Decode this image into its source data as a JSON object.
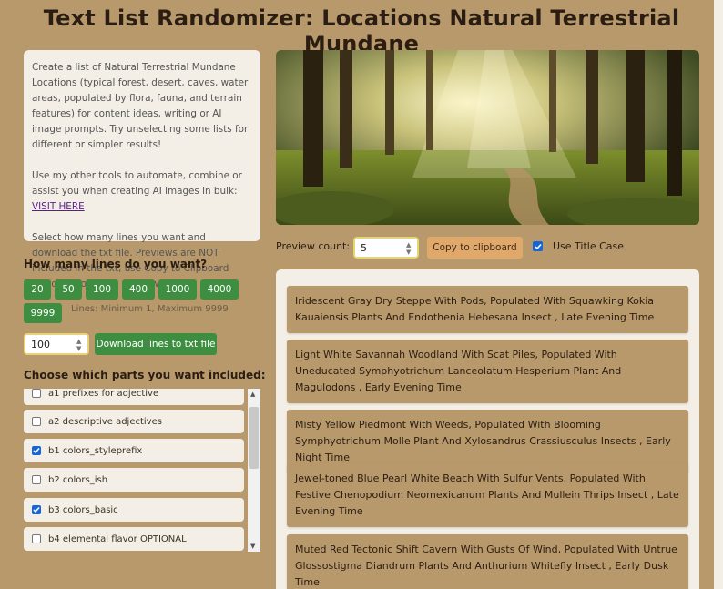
{
  "page_title": "Text List Randomizer: Locations Natural Terrestrial Mundane",
  "description": {
    "p1": "Create a list of Natural Terrestrial Mundane Locations (typical forest, desert, caves, water areas, populated by flora, fauna, and terrain features) for content ideas, writing or AI image prompts. Try unselecting some lists for different or simpler results!",
    "p2_text": "Use my other tools to automate, combine or assist you when creating AI images in bulk: ",
    "p2_link": "VISIT HERE",
    "p3": "Select how many lines you want and download the txt file. Previews are NOT included in the txt, use Copy to Clipboard button if you want preview lines."
  },
  "lines_section": {
    "title": "How many lines do you want?",
    "presets": [
      "20",
      "50",
      "100",
      "400",
      "1000",
      "4000",
      "9999"
    ],
    "hint": "Lines: Minimum 1, Maximum 9999",
    "input_value": "100",
    "download_label": "Download lines to txt file"
  },
  "parts_section": {
    "title": "Choose which parts you want included:",
    "items": [
      {
        "label": "a1 prefixes for adjective",
        "checked": false
      },
      {
        "label": "a2 descriptive adjectives",
        "checked": false
      },
      {
        "label": "b1 colors_styleprefix",
        "checked": true
      },
      {
        "label": "b2 colors_ish",
        "checked": false
      },
      {
        "label": "b3 colors_basic",
        "checked": true
      },
      {
        "label": "b4 elemental flavor OPTIONAL",
        "checked": false
      }
    ]
  },
  "preview": {
    "count_label": "Preview count:",
    "count_value": "5",
    "copy_label": "Copy to clipboard",
    "title_case_label": "Use Title Case",
    "title_case_checked": true
  },
  "results": [
    "Iridescent Gray Dry Steppe With Pods, Populated With Squawking Kokia Kauaiensis Plants And Endothenia Hebesana Insect , Late Evening Time",
    "Light White Savannah Woodland With Scat Piles, Populated With Uneducated Symphyotrichum Lanceolatum Hesperium Plant And Magulodons , Early Evening Time",
    "Misty Yellow Piedmont With Weeds, Populated With Blooming Symphyotrichum Molle Plant And Xylosandrus Crassiusculus Insects , Early Night Time",
    "Jewel-toned Blue Pearl White Beach With Sulfur Vents, Populated With Festive Chenopodium Neomexicanum Plants And Mullein Thrips Insect , Late Evening Time",
    "Muted Red Tectonic Shift Cavern With Gusts Of Wind, Populated With Untrue Glossostigma Diandrum Plants And Anthurium Whitefly Insect , Early Dusk Time"
  ],
  "colors": {
    "background": "#b8996c",
    "panel": "#f4efe6",
    "green_button": "#3e8e41",
    "copy_button": "#e0a86a",
    "checkbox_checked": "#1565d8"
  }
}
